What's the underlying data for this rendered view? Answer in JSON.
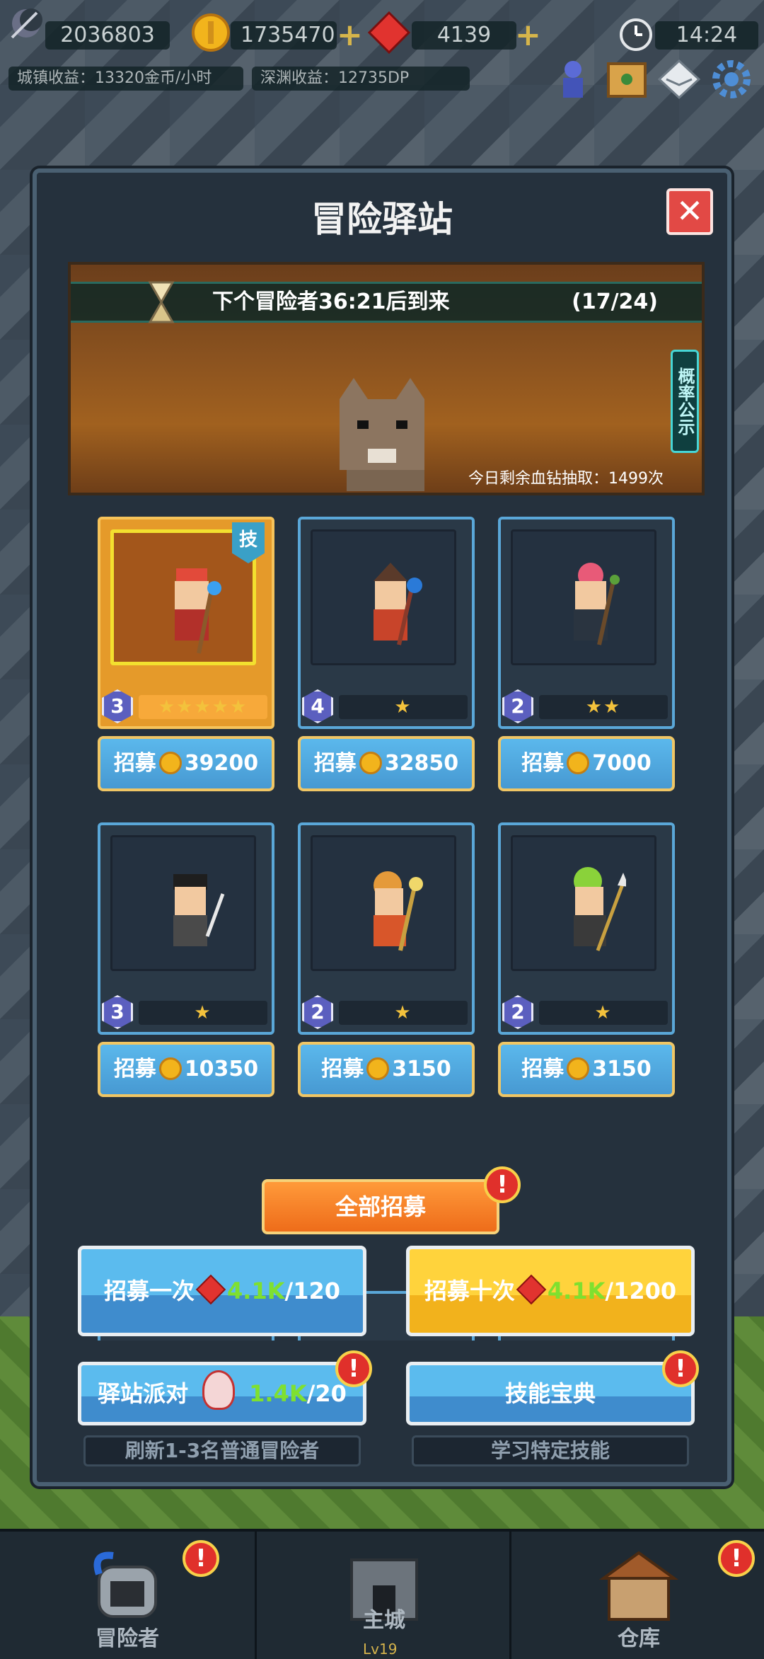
{
  "topbar": {
    "souls": "2036803",
    "gold": "1735470",
    "gems": "4139",
    "time": "14:24",
    "town_income": "城镇收益：13320金币/小时",
    "abyss_income": "深渊收益：12735DP"
  },
  "modal": {
    "title": "冒险驿站",
    "next_arrival": "下个冒险者36:21后到来",
    "queue_count": "(17/24)",
    "probability_tab": "概率公示",
    "draws_left": "今日剩余血钻抽取：1499次"
  },
  "cards": [
    {
      "level": "3",
      "stars": "★★★★★",
      "recruit_label": "招募",
      "cost": "39200",
      "selected": true,
      "tech_badge": "技"
    },
    {
      "level": "4",
      "stars": "★",
      "recruit_label": "招募",
      "cost": "32850"
    },
    {
      "level": "2",
      "stars": "★★",
      "recruit_label": "招募",
      "cost": "7000"
    },
    {
      "level": "3",
      "stars": "★",
      "recruit_label": "招募",
      "cost": "10350"
    },
    {
      "level": "2",
      "stars": "★",
      "recruit_label": "招募",
      "cost": "3150"
    },
    {
      "level": "2",
      "stars": "★",
      "recruit_label": "招募",
      "cost": "3150"
    }
  ],
  "actions": {
    "recruit_all": "全部招募",
    "recruit_once": "招募一次",
    "recruit_once_have": "4.1K",
    "recruit_once_cost": "/120",
    "recruit_ten": "招募十次",
    "recruit_ten_have": "4.1K",
    "recruit_ten_cost": "/1200",
    "party": "驿站派对",
    "party_have": "1.4K",
    "party_cost": "/20",
    "skill_book": "技能宝典",
    "party_desc": "刷新1-3名普通冒险者",
    "skill_desc": "学习特定技能"
  },
  "nav": {
    "adventurers": "冒险者",
    "main_city": "主城",
    "main_city_level": "Lv19",
    "warehouse": "仓库"
  },
  "icons": {
    "alert": "!",
    "close": "✕",
    "plus": "+"
  },
  "colors": {
    "accent_blue": "#5aa7d8",
    "accent_orange": "#ee6c1a",
    "gem_red": "#e1332f",
    "gold": "#f2b41c"
  }
}
